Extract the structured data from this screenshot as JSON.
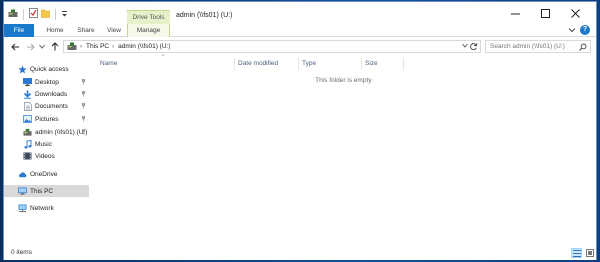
{
  "window": {
    "title": "admin (\\\\fs01) (U:)",
    "context_tab_group": "Drive Tools"
  },
  "ribbon": {
    "tabs": [
      {
        "label": "File",
        "active": true
      },
      {
        "label": "Home"
      },
      {
        "label": "Share"
      },
      {
        "label": "View"
      },
      {
        "label": "Manage",
        "contextual": true
      }
    ]
  },
  "address": {
    "crumbs": [
      "This PC",
      "admin (\\\\fs01) (U:)"
    ]
  },
  "search": {
    "placeholder": "Search admin (\\\\fs01) (U:)"
  },
  "nav": {
    "quick_access": "Quick access",
    "pinned": [
      {
        "label": "Desktop",
        "icon": "desktop-folder-icon"
      },
      {
        "label": "Downloads",
        "icon": "downloads-icon"
      },
      {
        "label": "Documents",
        "icon": "documents-icon"
      },
      {
        "label": "Pictures",
        "icon": "pictures-icon"
      },
      {
        "label": "admin (\\\\fs01) (U:)",
        "icon": "network-drive-icon"
      }
    ],
    "unpinned": [
      {
        "label": "Music",
        "icon": "music-icon"
      },
      {
        "label": "Videos",
        "icon": "videos-icon"
      }
    ],
    "onedrive": "OneDrive",
    "thispc": "This PC",
    "network": "Network"
  },
  "columns": [
    "Name",
    "Date modified",
    "Type",
    "Size"
  ],
  "empty_message": "This folder is empty.",
  "status": {
    "item_count": "0 items"
  },
  "colors": {
    "accent": "#1979ca",
    "context_tab": "#e7f1c9",
    "selection": "#d9d9d9",
    "column_header": "#4d6082"
  }
}
